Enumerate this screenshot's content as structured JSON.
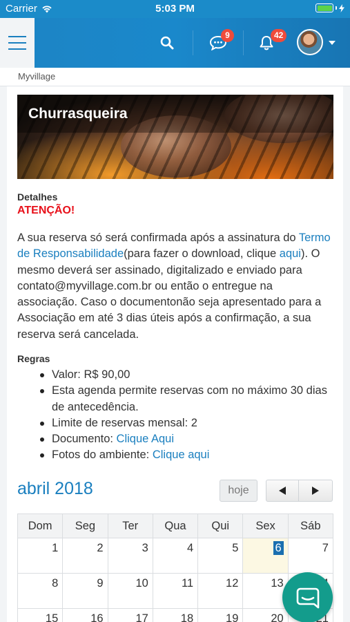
{
  "status_bar": {
    "carrier": "Carrier",
    "time": "5:03 PM"
  },
  "header": {
    "messages_badge": "9",
    "notifications_badge": "42",
    "icons": [
      "menu-icon",
      "search-icon",
      "chat-icon",
      "bell-icon",
      "avatar",
      "chevron-down-icon"
    ]
  },
  "breadcrumb": "Myvillage",
  "hero": {
    "title": "Churrasqueira"
  },
  "details": {
    "label": "Detalhes",
    "warning": "ATENÇÃO!",
    "text_1": "A sua reserva só será confirmada após a assinatura do ",
    "link_term": "Termo de Responsabilidade",
    "text_2": "(para fazer o download, clique ",
    "link_here": "aqui",
    "text_3": "). O mesmo deverá ser assinado, digitalizado e enviado para contato@myvillage.com.br ou então o entregue na associação. Caso o documentonão seja apresentado para a Associação em até 3 dias úteis após a confirmação, a sua reserva será cancelada."
  },
  "rules": {
    "label": "Regras",
    "items": [
      "Valor: R$ 90,00",
      "Esta agenda permite reservas com no máximo 30 dias de antecedência.",
      "Limite de reservas mensal: 2"
    ],
    "document_label": "Documento: ",
    "document_link": "Clique Aqui",
    "photos_label": "Fotos do ambiente: ",
    "photos_link": "Clique aqui"
  },
  "calendar": {
    "title": "abril 2018",
    "today_label": "hoje",
    "weekdays": [
      "Dom",
      "Seg",
      "Ter",
      "Qua",
      "Qui",
      "Sex",
      "Sáb"
    ],
    "highlighted_day": "6",
    "rows": [
      [
        "1",
        "2",
        "3",
        "4",
        "5",
        "6",
        "7"
      ],
      [
        "8",
        "9",
        "10",
        "11",
        "12",
        "13",
        "14"
      ],
      [
        "15",
        "16",
        "17",
        "18",
        "19",
        "20",
        "21"
      ]
    ]
  },
  "colors": {
    "brand": "#1a88cb",
    "link": "#1a7fbf",
    "warning": "#e8101a",
    "badge": "#ef4b3b",
    "fab": "#139c8c"
  }
}
